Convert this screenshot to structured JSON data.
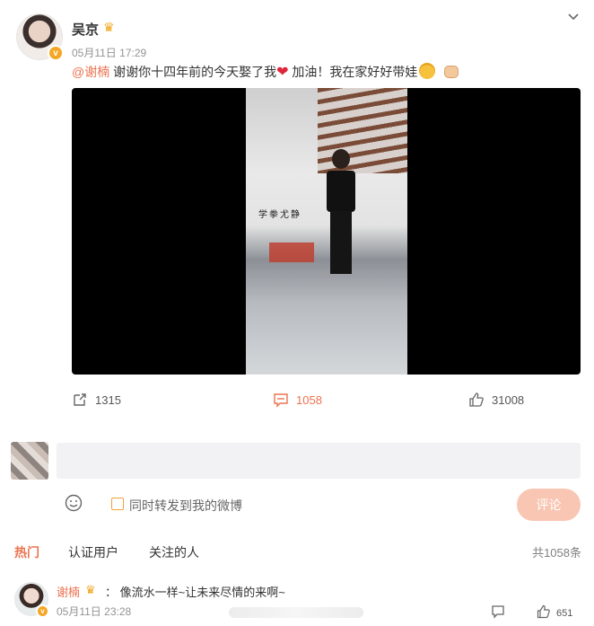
{
  "post": {
    "author": "吴京",
    "timestamp": "05月11日 17:29",
    "mention": "@谢楠",
    "text_before_heart": " 谢谢你十四年前的今天娶了我",
    "heart": "❤",
    "text_after_heart": " 加油！我在家好好带娃",
    "wall_text": "学拳尤静"
  },
  "actions": {
    "repost_count": "1315",
    "comment_count": "1058",
    "like_count": "31008"
  },
  "reply": {
    "placeholder": "",
    "repost_checkbox_label": "同时转发到我的微博",
    "submit_label": "评论"
  },
  "comments_section": {
    "tabs": [
      "热门",
      "认证用户",
      "关注的人"
    ],
    "total": "共1058条",
    "comments": [
      {
        "user": "谢楠",
        "text": "：  像流水一样~让未来尽情的来啊~",
        "time": "05月11日 23:28",
        "likes": "651"
      }
    ]
  },
  "colors": {
    "accent": "#eb7350",
    "crown": "#f2a51a",
    "verified": "#f5a623",
    "submit_disabled": "#f9c6b3",
    "input_bg": "#f2f2f5"
  },
  "icons": [
    "chevron-down-icon",
    "crown-icon",
    "verified-icon",
    "repost-icon",
    "comment-icon",
    "like-icon",
    "smiley-icon",
    "reply-icon"
  ]
}
